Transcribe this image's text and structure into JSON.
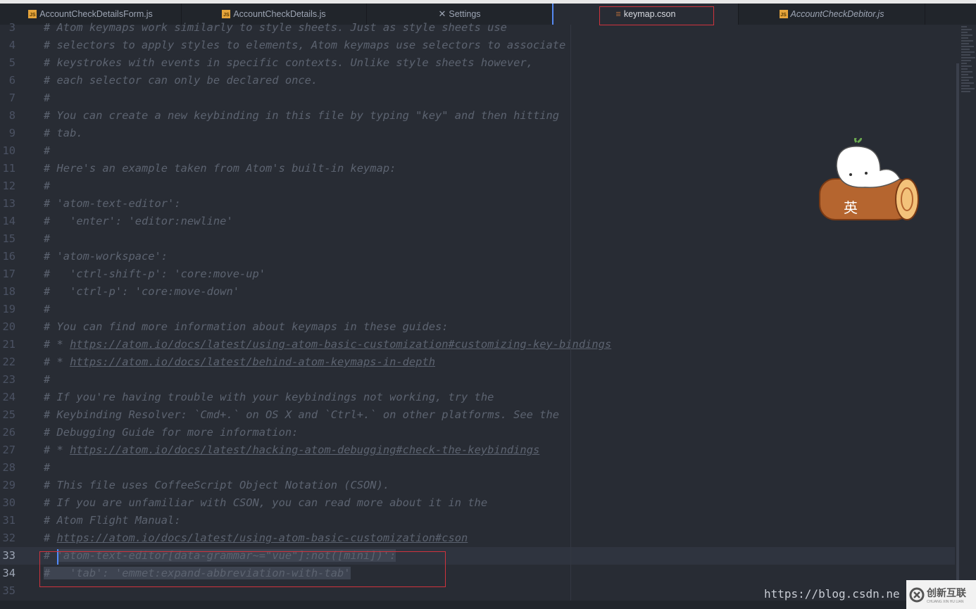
{
  "tabs": [
    {
      "label": "AccountCheckDetailsForm.js",
      "icon": "js-file-icon"
    },
    {
      "label": "AccountCheckDetails.js",
      "icon": "js-file-icon"
    },
    {
      "label": "Settings",
      "icon": "tools-icon"
    },
    {
      "label": "keymap.cson",
      "icon": "database-file-icon",
      "active": true
    },
    {
      "label": "AccountCheckDebitor.js",
      "icon": "js-file-icon",
      "italic": true
    }
  ],
  "lines": [
    {
      "n": "3",
      "t": "# Atom keymaps work similarly to style sheets. Just as style sheets use"
    },
    {
      "n": "4",
      "t": "# selectors to apply styles to elements, Atom keymaps use selectors to associate"
    },
    {
      "n": "5",
      "t": "# keystrokes with events in specific contexts. Unlike style sheets however,"
    },
    {
      "n": "6",
      "t": "# each selector can only be declared once."
    },
    {
      "n": "7",
      "t": "#"
    },
    {
      "n": "8",
      "t": "# You can create a new keybinding in this file by typing \"key\" and then hitting"
    },
    {
      "n": "9",
      "t": "# tab."
    },
    {
      "n": "10",
      "t": "#"
    },
    {
      "n": "11",
      "t": "# Here's an example taken from Atom's built-in keymap:"
    },
    {
      "n": "12",
      "t": "#"
    },
    {
      "n": "13",
      "t": "# 'atom-text-editor':"
    },
    {
      "n": "14",
      "t": "#   'enter': 'editor:newline'"
    },
    {
      "n": "15",
      "t": "#"
    },
    {
      "n": "16",
      "t": "# 'atom-workspace':"
    },
    {
      "n": "17",
      "t": "#   'ctrl-shift-p': 'core:move-up'"
    },
    {
      "n": "18",
      "t": "#   'ctrl-p': 'core:move-down'"
    },
    {
      "n": "19",
      "t": "#"
    },
    {
      "n": "20",
      "t": "# You can find more information about keymaps in these guides:"
    },
    {
      "n": "21",
      "p": "# * ",
      "u": "https://atom.io/docs/latest/using-atom-basic-customization#customizing-key-bindings"
    },
    {
      "n": "22",
      "p": "# * ",
      "u": "https://atom.io/docs/latest/behind-atom-keymaps-in-depth"
    },
    {
      "n": "23",
      "t": "#"
    },
    {
      "n": "24",
      "t": "# If you're having trouble with your keybindings not working, try the"
    },
    {
      "n": "25",
      "t": "# Keybinding Resolver: `Cmd+.` on OS X and `Ctrl+.` on other platforms. See the"
    },
    {
      "n": "26",
      "t": "# Debugging Guide for more information:"
    },
    {
      "n": "27",
      "p": "# * ",
      "u": "https://atom.io/docs/latest/hacking-atom-debugging#check-the-keybindings"
    },
    {
      "n": "28",
      "t": "#"
    },
    {
      "n": "29",
      "t": "# This file uses CoffeeScript Object Notation (CSON)."
    },
    {
      "n": "30",
      "t": "# If you are unfamiliar with CSON, you can read more about it in the"
    },
    {
      "n": "31",
      "t": "# Atom Flight Manual:"
    },
    {
      "n": "32",
      "p": "# ",
      "u": "https://atom.io/docs/latest/using-atom-basic-customization#cson"
    },
    {
      "n": "33",
      "p": "# ",
      "s": "'atom-text-editor[data-grammar~=\"vue\"]:not([mini])':",
      "cur": true
    },
    {
      "n": "34",
      "p": "",
      "s": "#   'tab': 'emmet:expand-abbreviation-with-tab'",
      "cur": true
    },
    {
      "n": "35",
      "t": ""
    }
  ],
  "mascot_text": "英",
  "watermark": "https://blog.csdn.ne",
  "logo": {
    "text": "创新互联",
    "subtext": "CHUANG XIN HU LIAN"
  },
  "colors": {
    "background": "#282c34",
    "comment": "#5c6370",
    "highlight_box": "#d0333d",
    "cursor": "#528bff"
  }
}
